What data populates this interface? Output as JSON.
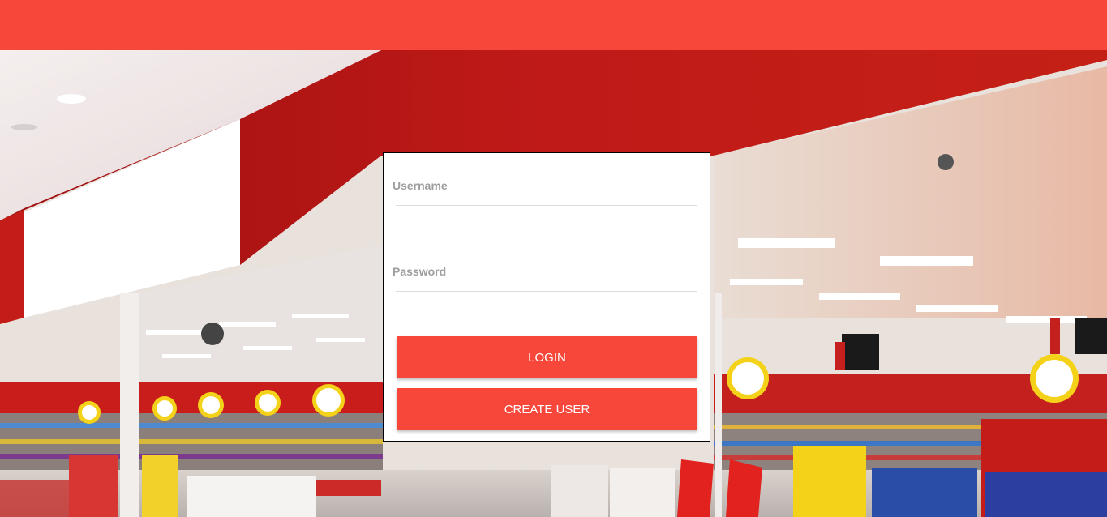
{
  "colors": {
    "brand_red": "#f7463a",
    "card_background": "#ffffff",
    "label_gray": "#9e9e9e"
  },
  "background": {
    "description_icon": "store-photo"
  },
  "login_form": {
    "username": {
      "label": "Username",
      "value": ""
    },
    "password": {
      "label": "Password",
      "value": ""
    },
    "login_button": "LOGIN",
    "create_user_button": "CREATE USER"
  }
}
